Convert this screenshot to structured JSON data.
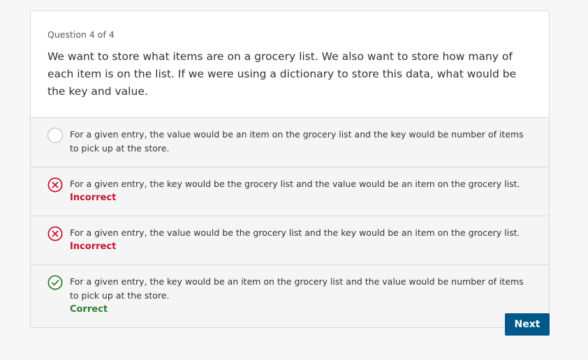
{
  "quiz": {
    "counter": "Question 4 of 4",
    "prompt": "We want to store what items are on a grocery list. We also want to store how many of each item is on the list. If we were using a dictionary to store this data, what would be the key and value.",
    "options": [
      {
        "text": "For a given entry, the value would be an item on the grocery list and the key would be number of items to pick up at the store.",
        "state": "unselected",
        "feedback": ""
      },
      {
        "text": "For a given entry, the key would be the grocery list and the value would be an item on the grocery list.",
        "state": "incorrect",
        "feedback": "Incorrect"
      },
      {
        "text": "For a given entry, the value would be the grocery list and the key would be an item on the grocery list.",
        "state": "incorrect",
        "feedback": "Incorrect"
      },
      {
        "text": "For a given entry, the key would be an item on the grocery list and the value would be number of items to pick up at the store.",
        "state": "correct",
        "feedback": "Correct"
      }
    ],
    "next_label": "Next"
  },
  "colors": {
    "incorrect": "#c8102e",
    "correct": "#2e7d32",
    "button": "#00588a"
  },
  "icons": {
    "unselected": "radio-circle-icon",
    "incorrect": "x-circle-icon",
    "correct": "check-circle-icon"
  }
}
